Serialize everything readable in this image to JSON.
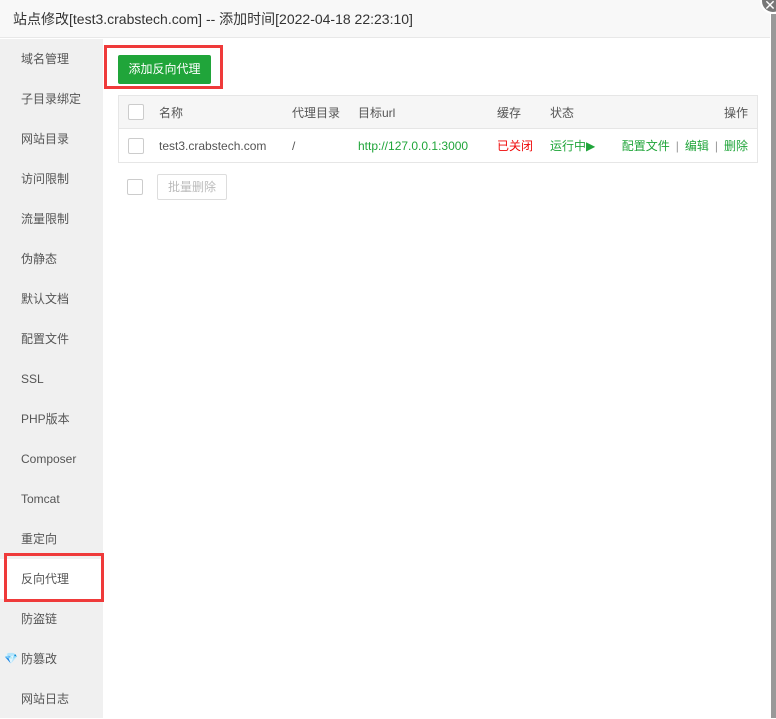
{
  "window": {
    "title": "站点修改[test3.crabstech.com] -- 添加时间[2022-04-18 22:23:10]",
    "close_icon": "close-icon"
  },
  "sidebar": {
    "items": [
      {
        "label": "域名管理"
      },
      {
        "label": "子目录绑定"
      },
      {
        "label": "网站目录"
      },
      {
        "label": "访问限制"
      },
      {
        "label": "流量限制"
      },
      {
        "label": "伪静态"
      },
      {
        "label": "默认文档"
      },
      {
        "label": "配置文件"
      },
      {
        "label": "SSL"
      },
      {
        "label": "PHP版本"
      },
      {
        "label": "Composer"
      },
      {
        "label": "Tomcat"
      },
      {
        "label": "重定向"
      },
      {
        "label": "反向代理",
        "active": true
      },
      {
        "label": "防盗链"
      },
      {
        "label": "防篡改",
        "icon": "diamond-icon"
      },
      {
        "label": "网站日志"
      }
    ]
  },
  "main": {
    "add_button": "添加反向代理",
    "columns": [
      "名称",
      "代理目录",
      "目标url",
      "缓存",
      "状态",
      "操作"
    ],
    "rows": [
      {
        "name": "test3.crabstech.com",
        "dir": "/",
        "url": "http://127.0.0.1:3000",
        "cache": "已关闭",
        "status": "运行中▶",
        "actions": [
          "配置文件",
          "编辑",
          "删除"
        ]
      }
    ],
    "bulk_delete": "批量删除"
  },
  "colors": {
    "accent": "#20a53a",
    "danger": "#ef0808",
    "highlight": "#ef3a3a"
  }
}
